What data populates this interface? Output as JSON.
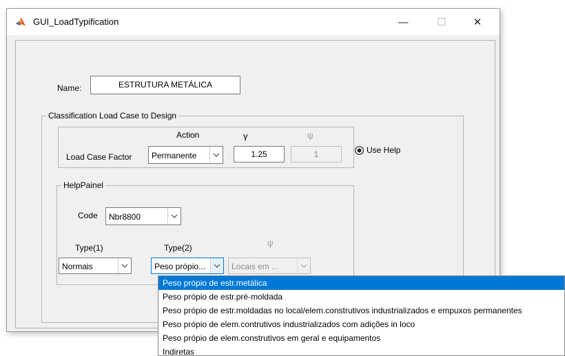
{
  "window": {
    "title": "GUI_LoadTypification",
    "minimize": "—",
    "maximize": "☐",
    "close": "✕"
  },
  "name_field": {
    "label": "Name:",
    "value": "ESTRUTURA METÁLICA"
  },
  "classification_panel": {
    "title": "Classification Load Case to Design",
    "action_header": "Action",
    "gamma_header": "γ",
    "psi_header": "ψ",
    "row_label": "Load Case Factor",
    "action_value": "Permanente",
    "gamma_value": "1.25",
    "psi_value": "1",
    "use_help_label": "Use Help",
    "use_help_selected": true
  },
  "help_panel": {
    "title": "HelpPainel",
    "code_label": "Code",
    "code_value": "Nbr8800",
    "type1_label": "Type(1)",
    "type2_label": "Type(2)",
    "psi_label": "ψ",
    "type1_value": "Normais",
    "type2_value": "Peso própio...",
    "psi_value": "Locais em ..."
  },
  "dropdown": {
    "items": [
      "Peso própio de estr.metálica",
      "Peso própio de estr.pré-moldada",
      "Peso própio de estr.moldadas no local/elem.construtivos industrializados e empuxos permanentes",
      "Peso própio de elem.contrutivos industrializados com adições in loco",
      "Peso própio de elem.construtivos  em geral e equipamentos",
      "Indiretas"
    ],
    "selected_index": 0
  },
  "colors": {
    "selection": "#0078d7",
    "background": "#f0f0f0"
  },
  "icons": {
    "app": "matlab-icon",
    "dropdown_arrow": "chevron-down-icon"
  }
}
